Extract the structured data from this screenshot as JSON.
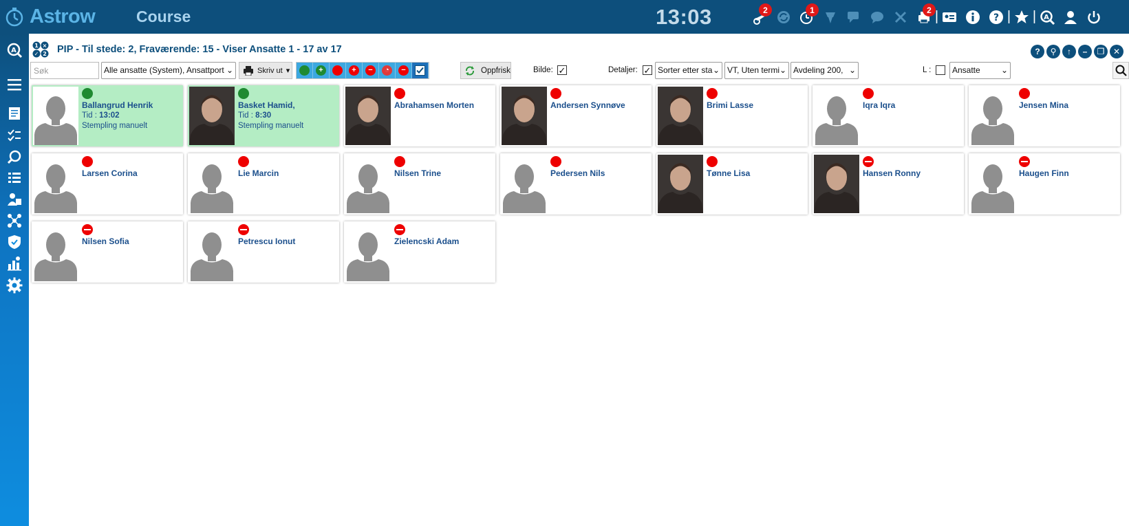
{
  "app": {
    "brand": "Astrow",
    "module": "Course",
    "clock": "13:03"
  },
  "topbar": {
    "icons": [
      {
        "name": "plane-warning-icon",
        "badge": "2",
        "dim": false
      },
      {
        "name": "sync-icon",
        "badge": "",
        "dim": true
      },
      {
        "name": "clock-alert-icon",
        "badge": "1",
        "dim": false
      },
      {
        "name": "award-icon",
        "badge": "",
        "dim": true
      },
      {
        "name": "chat-icon",
        "badge": "",
        "dim": true
      },
      {
        "name": "comment-icon",
        "badge": "",
        "dim": true
      },
      {
        "name": "tools-icon",
        "badge": "",
        "dim": true
      },
      {
        "name": "printer-icon",
        "badge": "2",
        "dim": false
      },
      {
        "name": "id-card-icon",
        "badge": "",
        "dim": false
      },
      {
        "name": "info-icon",
        "badge": "",
        "dim": false
      },
      {
        "name": "help-icon",
        "badge": "",
        "dim": false
      },
      {
        "name": "star-icon",
        "badge": "",
        "dim": false
      },
      {
        "name": "astrow-search-icon",
        "badge": "",
        "dim": false
      },
      {
        "name": "user-icon",
        "badge": "",
        "dim": false
      },
      {
        "name": "power-icon",
        "badge": "",
        "dim": false
      }
    ]
  },
  "panel": {
    "title": "PIP - Til stede: 2, Fraværende: 15 - Viser Ansatte 1 - 17 av 17"
  },
  "toolbar": {
    "search_placeholder": "Søk",
    "employees_select": "Alle ansatte (System), Ansattport",
    "print_label": "Skriv ut",
    "refresh_label": "Oppfrisk",
    "picture_label": "Bilde:",
    "details_label": "Detaljer:",
    "sort_select": "Sorter etter sta",
    "vt_select": "VT, Uten termi",
    "department_select": "Avdeling 200,",
    "l_label": "L :",
    "employee_type_select": "Ansatte"
  },
  "employees": [
    {
      "name": "Ballangrud Henrik",
      "status": "present",
      "time_label": "Tid :",
      "time": "13:02",
      "note": "Stempling manuelt",
      "photo": false
    },
    {
      "name": "Basket Hamid,",
      "status": "present",
      "time_label": "Tid :",
      "time": "8:30",
      "note": "Stempling manuelt",
      "photo": true
    },
    {
      "name": "Abrahamsen Morten",
      "status": "absent",
      "photo": true
    },
    {
      "name": "Andersen Synnøve",
      "status": "absent",
      "photo": true
    },
    {
      "name": "Brimi Lasse",
      "status": "absent",
      "photo": true
    },
    {
      "name": "Iqra Iqra",
      "status": "absent",
      "photo": false
    },
    {
      "name": "Jensen Mina",
      "status": "absent",
      "photo": false
    },
    {
      "name": "Larsen Corina",
      "status": "absent",
      "photo": false
    },
    {
      "name": "Lie Marcin",
      "status": "absent",
      "photo": false
    },
    {
      "name": "Nilsen Trine",
      "status": "absent",
      "photo": false
    },
    {
      "name": "Pedersen Nils",
      "status": "absent",
      "photo": false
    },
    {
      "name": "Tønne Lisa",
      "status": "absent",
      "photo": true
    },
    {
      "name": "Hansen Ronny",
      "status": "leave",
      "photo": true
    },
    {
      "name": "Haugen Finn",
      "status": "leave",
      "photo": false
    },
    {
      "name": "Nilsen Sofia",
      "status": "leave",
      "photo": false
    },
    {
      "name": "Petrescu Ionut",
      "status": "leave",
      "photo": false
    },
    {
      "name": "Zielencski Adam",
      "status": "leave",
      "photo": false
    }
  ],
  "colors": {
    "topbar": "#0d4f7c",
    "present_card": "#b4edc4",
    "present_dot": "#1f8a31",
    "absent_dot": "#ee0000",
    "name_text": "#1b4f8c"
  }
}
